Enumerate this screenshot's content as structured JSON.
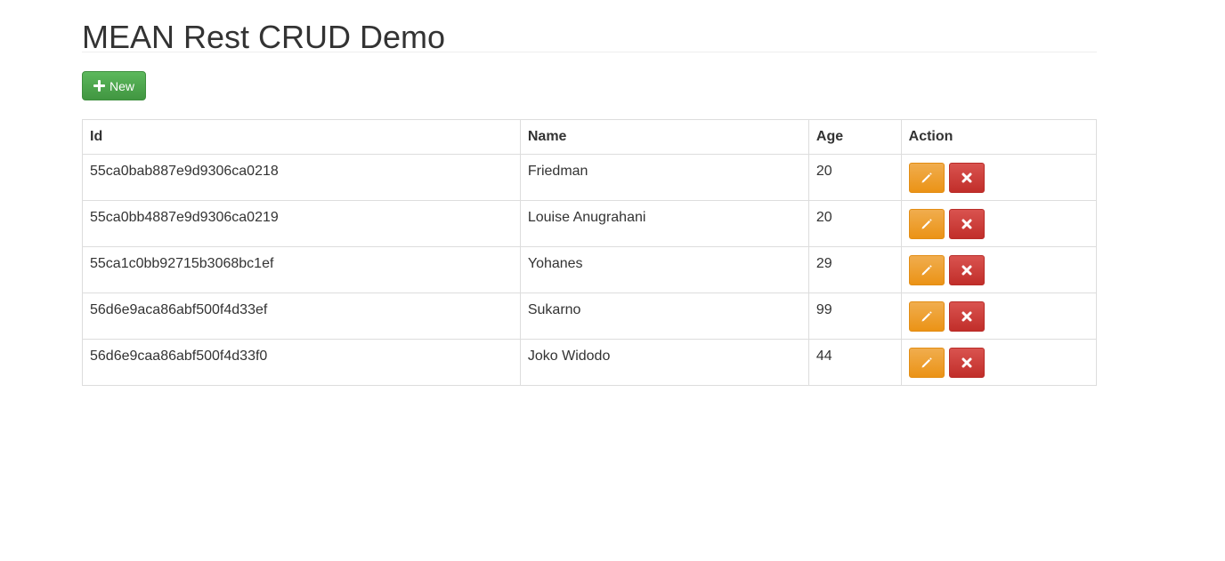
{
  "page": {
    "title": "MEAN Rest CRUD Demo"
  },
  "toolbar": {
    "new_label": "New",
    "new_icon": "plus-icon"
  },
  "table": {
    "headers": {
      "id": "Id",
      "name": "Name",
      "age": "Age",
      "action": "Action"
    },
    "rows": [
      {
        "id": "55ca0bab887e9d9306ca0218",
        "name": "Friedman",
        "age": "20"
      },
      {
        "id": "55ca0bb4887e9d9306ca0219",
        "name": "Louise Anugrahani",
        "age": "20"
      },
      {
        "id": "55ca1c0bb92715b3068bc1ef",
        "name": "Yohanes",
        "age": "29"
      },
      {
        "id": "56d6e9aca86abf500f4d33ef",
        "name": "Sukarno",
        "age": "99"
      },
      {
        "id": "56d6e9caa86abf500f4d33f0",
        "name": "Joko Widodo",
        "age": "44"
      }
    ],
    "row_actions": {
      "edit_icon": "pencil-icon",
      "delete_icon": "remove-icon"
    }
  },
  "colors": {
    "success": "#5cb85c",
    "warning": "#f0ad4e",
    "danger": "#d9534f"
  }
}
